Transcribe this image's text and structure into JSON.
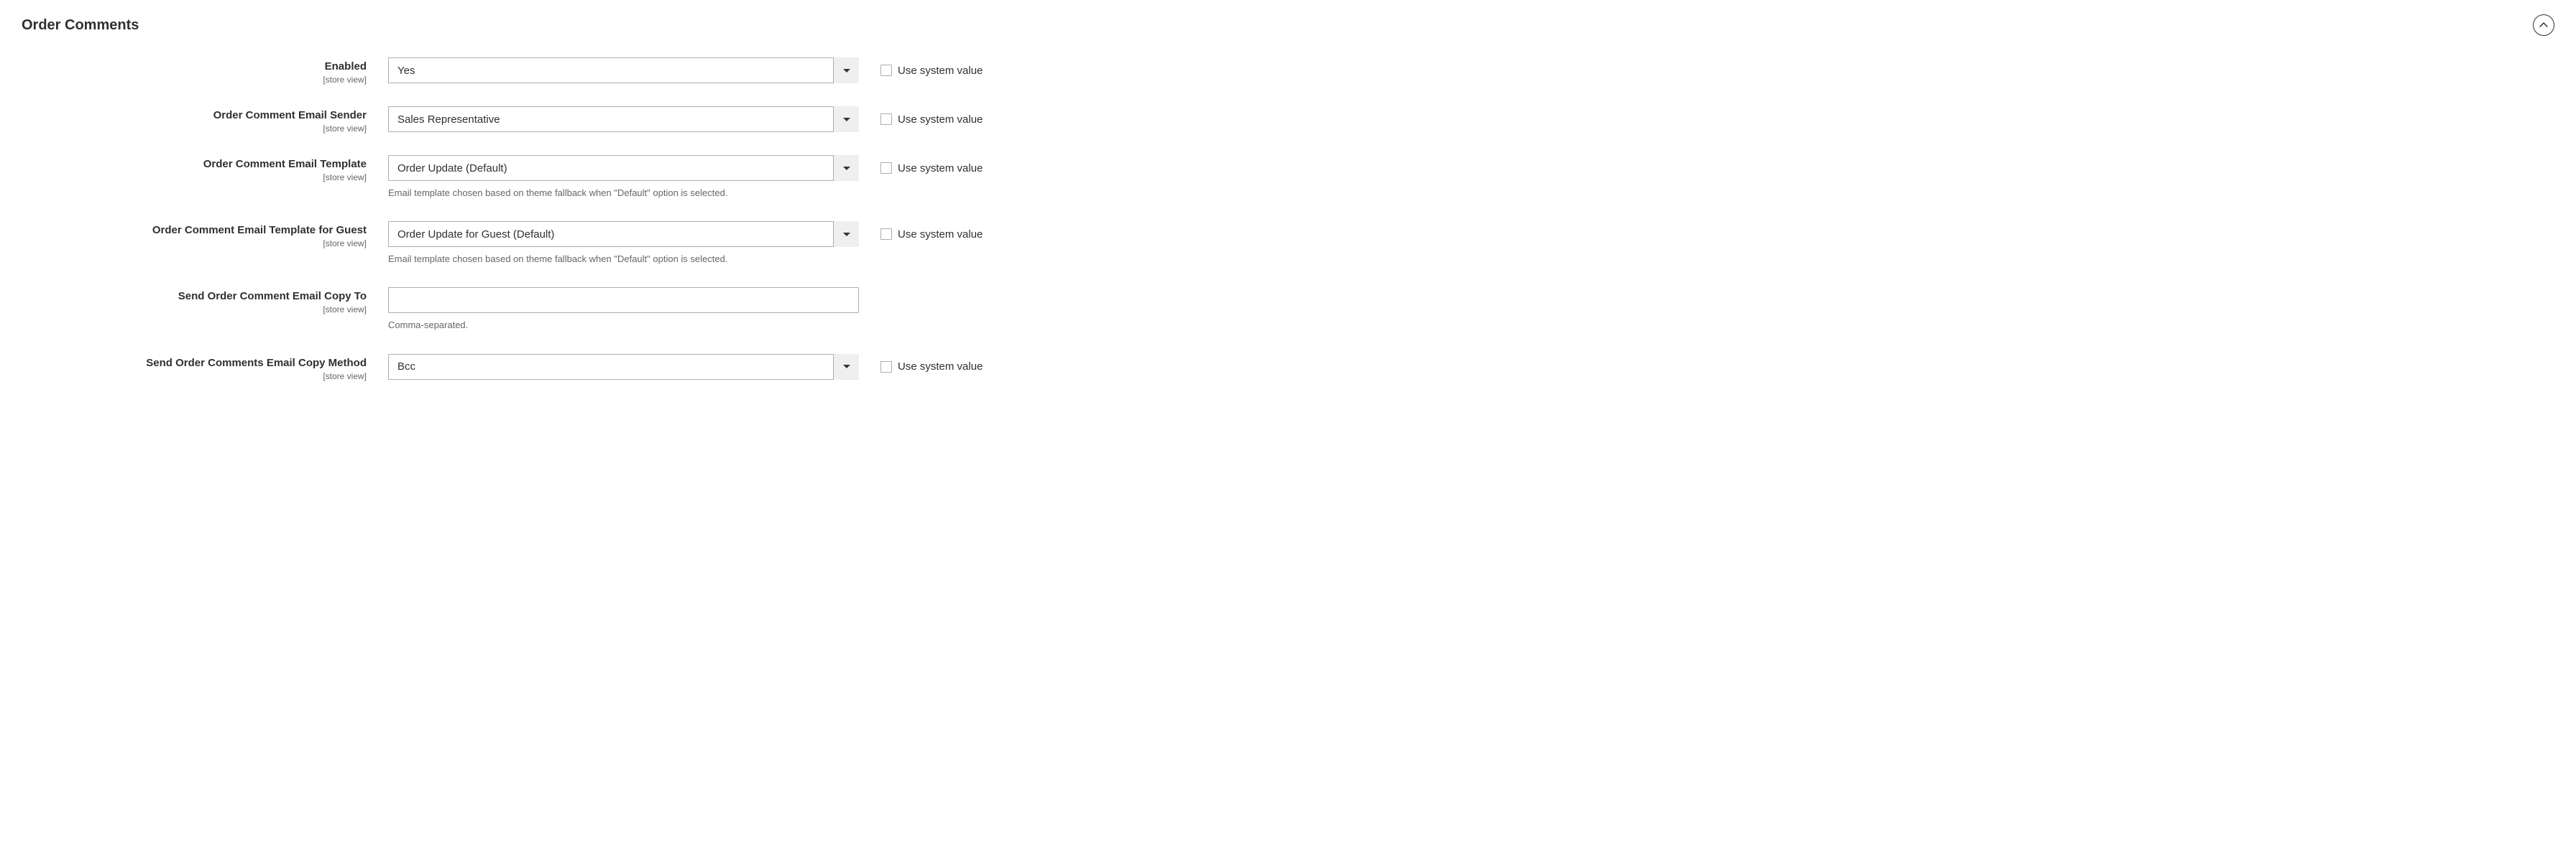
{
  "section": {
    "title": "Order Comments",
    "use_system_value_label": "Use system value",
    "scope_label": "[store view]"
  },
  "fields": {
    "enabled": {
      "label": "Enabled",
      "value": "Yes"
    },
    "sender": {
      "label": "Order Comment Email Sender",
      "value": "Sales Representative"
    },
    "template": {
      "label": "Order Comment Email Template",
      "value": "Order Update (Default)",
      "hint": "Email template chosen based on theme fallback when \"Default\" option is selected."
    },
    "template_guest": {
      "label": "Order Comment Email Template for Guest",
      "value": "Order Update for Guest (Default)",
      "hint": "Email template chosen based on theme fallback when \"Default\" option is selected."
    },
    "copy_to": {
      "label": "Send Order Comment Email Copy To",
      "value": "",
      "hint": "Comma-separated."
    },
    "copy_method": {
      "label": "Send Order Comments Email Copy Method",
      "value": "Bcc"
    }
  }
}
